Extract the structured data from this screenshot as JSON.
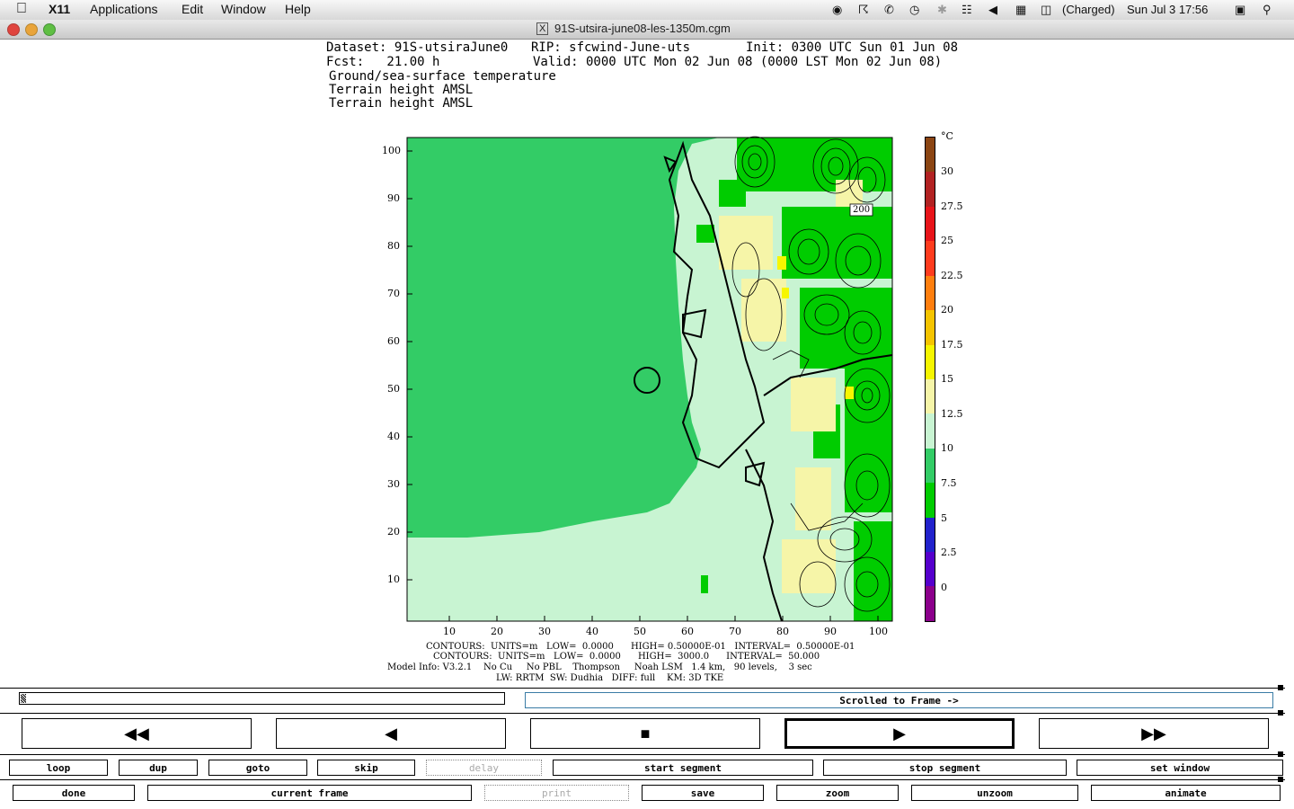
{
  "menubar": {
    "app": "X11",
    "items": [
      "Applications",
      "Edit",
      "Window",
      "Help"
    ],
    "status": {
      "battery": "(Charged)",
      "clock": "Sun Jul 3  17:56"
    }
  },
  "window": {
    "title": "91S-utsira-june08-les-1350m.cgm"
  },
  "header": {
    "line1a": "Dataset: 91S-utsiraJune0",
    "line1b": "RIP: sfcwind-June-uts",
    "line1c": "Init: 0300 UTC Sun 01 Jun 08",
    "line2a": "Fcst:   21.00 h",
    "line2b": "Valid: 0000 UTC Mon 02 Jun 08 (0000 LST Mon 02 Jun 08)",
    "line3": "Ground/sea-surface temperature",
    "line4": "Terrain height AMSL",
    "line5": "Terrain height AMSL"
  },
  "plot": {
    "yticks": [
      "100",
      "90",
      "80",
      "70",
      "60",
      "50",
      "40",
      "30",
      "20",
      "10"
    ],
    "xticks": [
      "10",
      "20",
      "30",
      "40",
      "50",
      "60",
      "70",
      "80",
      "90",
      "100"
    ],
    "contour_label": "200"
  },
  "colorbar": {
    "unit": "°C",
    "labels": [
      "30",
      "27.5",
      "25",
      "22.5",
      "20",
      "17.5",
      "15",
      "12.5",
      "10",
      "7.5",
      "5",
      "2.5",
      "0"
    ],
    "colors": [
      "#8b4513",
      "#b22222",
      "#e8141a",
      "#ff3c1e",
      "#ff7f0e",
      "#f5c400",
      "#f6f600",
      "#f6f5a8",
      "#c8f4d2",
      "#33cc66",
      "#00cc00",
      "#2222cc",
      "#5500cc",
      "#8b008b"
    ]
  },
  "footer": {
    "line1": "CONTOURS:  UNITS=m   LOW=  0.0000      HIGH= 0.50000E-01   INTERVAL=  0.50000E-01",
    "line2": "CONTOURS:  UNITS=m   LOW=  0.0000      HIGH=  3000.0      INTERVAL=  50.000",
    "line3": "Model Info: V3.2.1    No Cu     No PBL    Thompson     Noah LSM   1.4 km,   90 levels,    3 sec",
    "line4": "LW: RRTM  SW: Dudhia   DIFF: full    KM: 3D TKE"
  },
  "controls": {
    "status": "Scrolled to Frame ->",
    "nav": [
      "rewind",
      "step-back",
      "stop",
      "play",
      "fast-forward"
    ],
    "row1": [
      "loop",
      "dup",
      "goto",
      "skip",
      "delay",
      "start segment",
      "stop segment",
      "set window"
    ],
    "row2": [
      "done",
      "current frame",
      "print",
      "save",
      "zoom",
      "unzoom",
      "animate"
    ]
  }
}
